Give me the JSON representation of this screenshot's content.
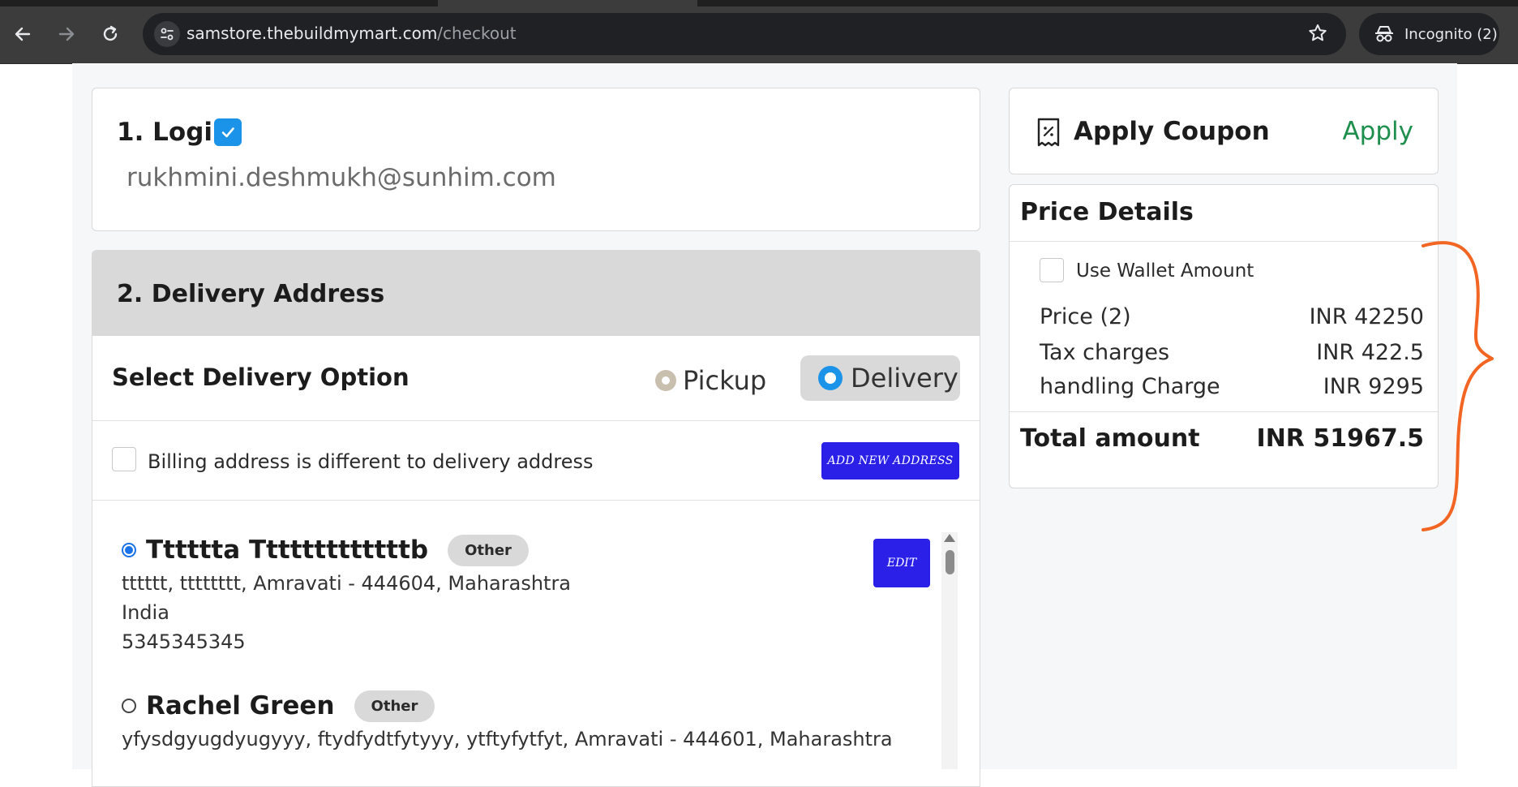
{
  "browser": {
    "url_host": "samstore.thebuildmymart.com",
    "url_path": "/checkout",
    "incognito_label": "Incognito (2)"
  },
  "login": {
    "title": "1. Login",
    "email": "rukhmini.deshmukh@sunhim.com"
  },
  "delivery": {
    "title": "2. Delivery Address",
    "option_title": "Select Delivery Option",
    "pickup_label": "Pickup",
    "delivery_label": "Delivery",
    "selected_option": "Delivery",
    "billing_label": "Billing address is different to delivery address",
    "add_button": "ADD NEW ADDRESS",
    "edit_button": "EDIT",
    "addresses": [
      {
        "name": "Tttttta Tttttttttttttb",
        "type": "Other",
        "selected": true,
        "line1": "tttttt, tttttttt, Amravati - 444604, Maharashtra",
        "line2": "India",
        "line3": "5345345345"
      },
      {
        "name": "Rachel Green",
        "type": "Other",
        "selected": false,
        "line1": "yfysdgyugdyugyyy, ftydfydtfytyyy, ytftyfytfyt, Amravati - 444601, Maharashtra"
      }
    ]
  },
  "coupon": {
    "title": "Apply Coupon",
    "apply_label": "Apply"
  },
  "price_details": {
    "title": "Price Details",
    "wallet_label": "Use Wallet Amount",
    "rows": [
      {
        "label": "Price (2)",
        "value": "INR 42250"
      },
      {
        "label": "Tax charges",
        "value": "INR 422.5"
      },
      {
        "label": "handling Charge",
        "value": "INR 9295"
      }
    ],
    "total_label": "Total amount",
    "total_value": "INR 51967.5"
  },
  "colors": {
    "primary_button": "#2a20e8",
    "accent_blue": "#1a93e8",
    "apply_green": "#1f8f4e",
    "annotation_orange": "#f26522"
  }
}
